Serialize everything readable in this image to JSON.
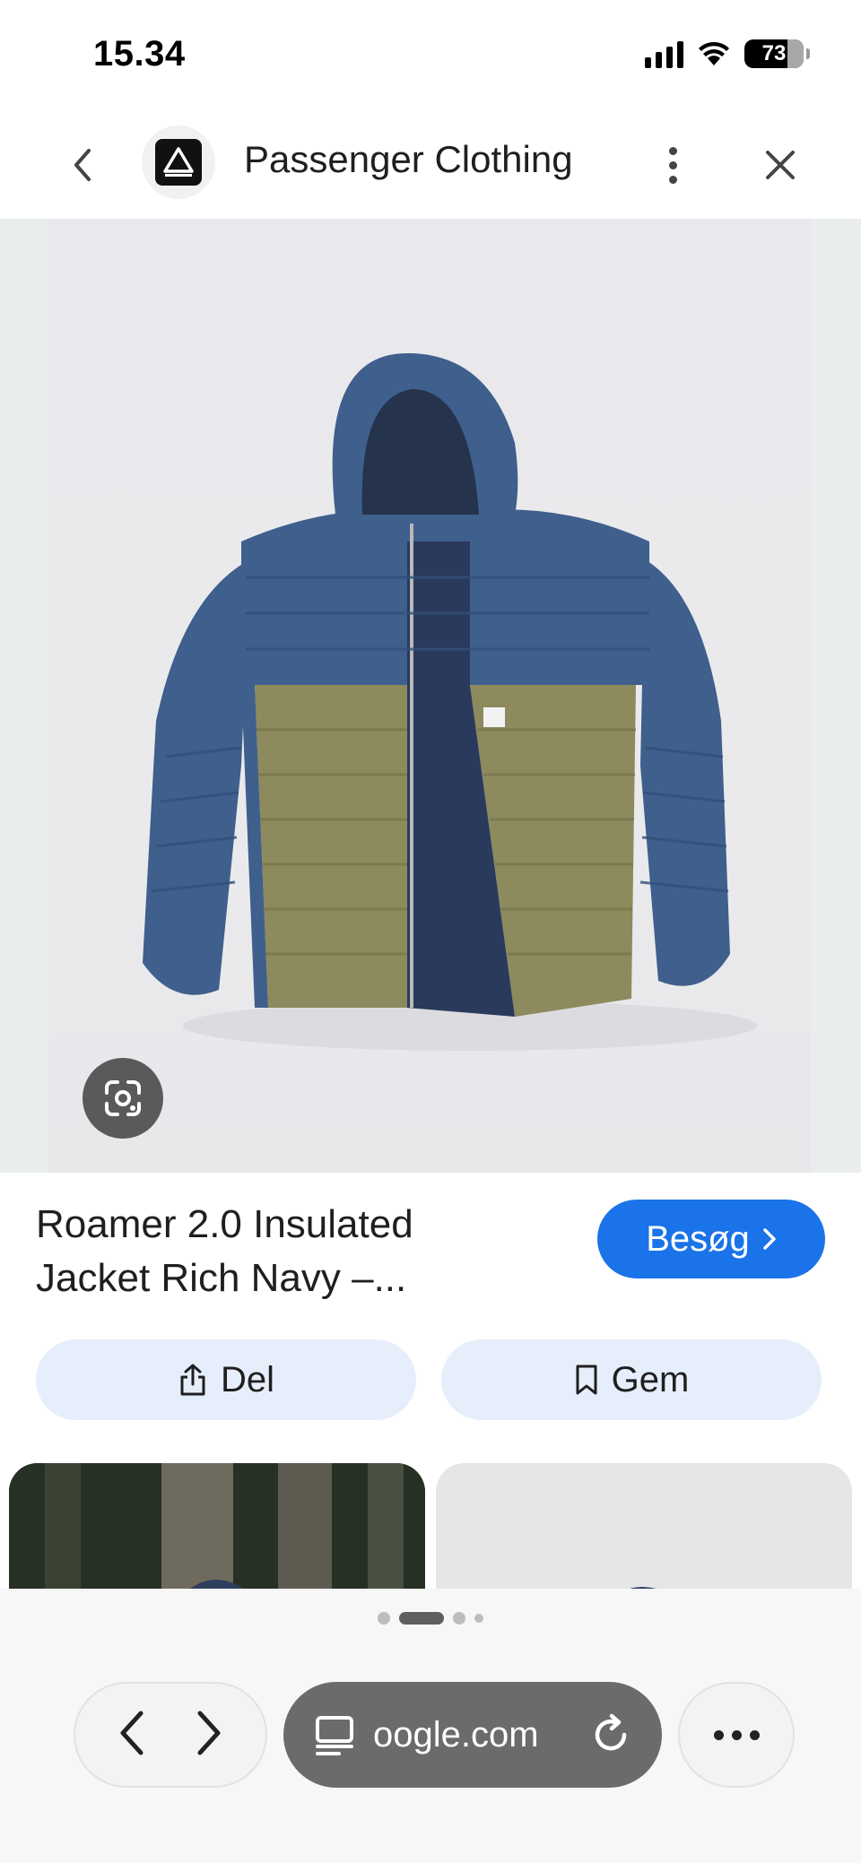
{
  "status_bar": {
    "time": "15.34",
    "battery": "73"
  },
  "header": {
    "site_name": "Passenger Clothing"
  },
  "product": {
    "title": "Roamer 2.0 Insulated Jacket Rich Navy –...",
    "visit_label": "Besøg",
    "share_label": "Del",
    "save_label": "Gem"
  },
  "browser": {
    "url": "oogle.com"
  },
  "icons": {
    "back": "chevron-left-icon",
    "site_logo": "passenger-logo-icon",
    "menu": "more-vert-icon",
    "close": "close-icon",
    "lens": "google-lens-icon",
    "share": "share-icon",
    "save": "bookmark-icon",
    "browser_back": "chevron-left-icon",
    "browser_forward": "chevron-right-icon",
    "tabs": "page-menu-icon",
    "reload": "reload-icon",
    "more": "more-horiz-icon"
  },
  "colors": {
    "accent": "#1a73e8",
    "action_button_bg": "#e7eefb",
    "jacket_navy": "#3f5f8c",
    "jacket_olive": "#8d8a5e"
  }
}
